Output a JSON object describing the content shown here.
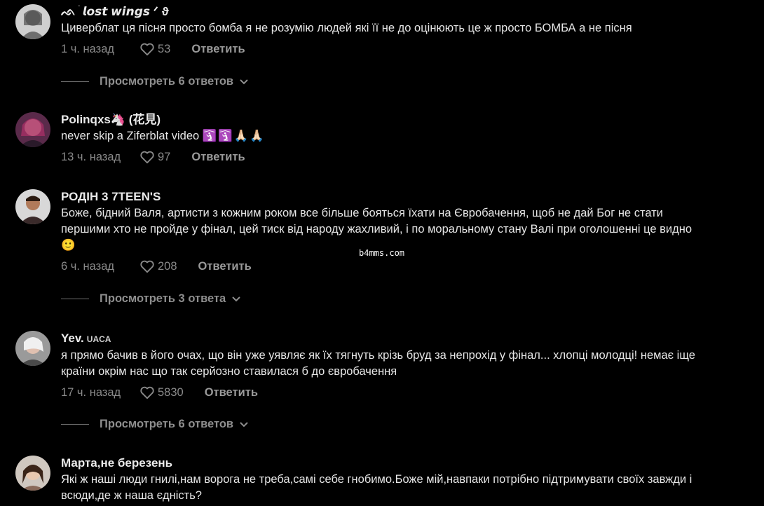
{
  "comments": [
    {
      "username": "ᨒ ׄ 𝙡𝙤𝙨𝙩 𝙬𝙞𝙣𝙜𝙨 ᐟ ϑ",
      "text": "Циверблат ця пісня просто бомба я не розумію людей які її не до оцінюють це ж просто БОМБА а не пісня",
      "time": "1 ч. назад",
      "likes": "53",
      "reply_label": "Ответить",
      "replies_label": "Просмотреть 6 ответов"
    },
    {
      "username": "Polinqxs🦄 (花見)",
      "text": "never skip a Ziferblat video",
      "text_emoji": [
        "🛐",
        "🛐",
        "🙏🏻",
        "🙏🏻"
      ],
      "time": "13 ч. назад",
      "likes": "97",
      "reply_label": "Ответить"
    },
    {
      "username": "РОДІН 3 7TEEN'S",
      "text_line1": "Боже, бідний Валя, артисти з кожним роком все більше бояться їхати на Євробачення, щоб не дай Бог не стати",
      "text_line2": "першими хто не пройде у фінал, цей тиск від народу жахливий, і по моральному стану Валі при оголошенні це видно",
      "text_emoji": "🙂",
      "time": "6 ч. назад",
      "likes": "208",
      "reply_label": "Ответить",
      "replies_label": "Просмотреть 3 ответа"
    },
    {
      "username": "Yev.",
      "badge": "UACA",
      "text_line1": "я прямо бачив в його очах, що він уже уявляє як їх тягнуть крізь бруд за непрохід у фінал... хлопці молодці! немає іще",
      "text_line2": "країни окрім нас що так серйозно ставилася б до євробачення",
      "time": "17 ч. назад",
      "likes": "5830",
      "reply_label": "Ответить",
      "replies_label": "Просмотреть 6 ответов"
    },
    {
      "username": "Марта,не березень",
      "text_line1": "Які ж наші люди гнилі,нам ворога не треба,самі себе гнобимо.Боже мій,навпаки потрібно підтримувати своїх завжди і",
      "text_line2": "всюди,де ж наша єдність?"
    }
  ],
  "watermark": "b4mms.com",
  "colors": {
    "background": "#000000",
    "text": "#e6e6e6",
    "muted": "#8a8a8a"
  }
}
